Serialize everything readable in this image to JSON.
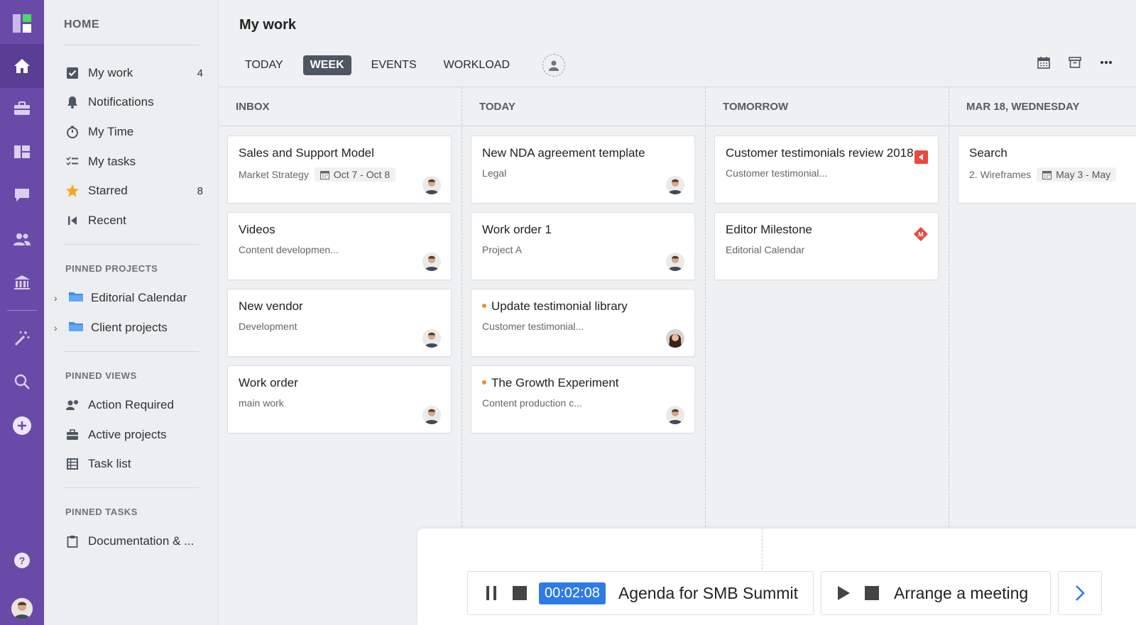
{
  "colors": {
    "rail": "#6a4aa8",
    "accent": "#2f7be5",
    "star": "#f5a623",
    "red_flag": "#e84a3c",
    "dot_orange": "#f28a33"
  },
  "rail": {
    "icons": [
      "logo-icon",
      "home-icon",
      "briefcase-icon",
      "dashboard-icon",
      "chat-icon",
      "users-icon",
      "bank-icon",
      "magic-wand-icon",
      "search-icon",
      "plus-icon",
      "help-icon"
    ]
  },
  "sidebar": {
    "home_label": "HOME",
    "items": [
      {
        "label": "My work",
        "count": "4",
        "icon": "checkbox-icon"
      },
      {
        "label": "Notifications",
        "count": "",
        "icon": "bell-icon"
      },
      {
        "label": "My Time",
        "count": "",
        "icon": "stopwatch-icon"
      },
      {
        "label": "My tasks",
        "count": "",
        "icon": "task-list-icon"
      },
      {
        "label": "Starred",
        "count": "8",
        "icon": "star-icon"
      },
      {
        "label": "Recent",
        "count": "",
        "icon": "recent-icon"
      }
    ],
    "pinned_projects_label": "PINNED PROJECTS",
    "pinned_projects": [
      "Editorial Calendar",
      "Client projects"
    ],
    "pinned_views_label": "PINNED VIEWS",
    "pinned_views": [
      {
        "label": "Action Required",
        "icon": "user-alert-icon"
      },
      {
        "label": "Active projects",
        "icon": "briefcase-icon"
      },
      {
        "label": "Task list",
        "icon": "table-icon"
      }
    ],
    "pinned_tasks_label": "PINNED TASKS",
    "pinned_tasks": [
      {
        "label": "Documentation & ...",
        "icon": "clipboard-icon"
      }
    ]
  },
  "header": {
    "title": "My work",
    "tabs": [
      "TODAY",
      "WEEK",
      "EVENTS",
      "WORKLOAD"
    ],
    "active_tab": "WEEK"
  },
  "columns": [
    {
      "title": "INBOX",
      "cards": [
        {
          "title": "Sales and Support Model",
          "sub": "Market Strategy",
          "date": "Oct 7 - Oct 8",
          "dot": false,
          "avatar": "man"
        },
        {
          "title": "Videos",
          "sub": "Content developmen...",
          "date": "",
          "dot": false,
          "avatar": "man"
        },
        {
          "title": "New vendor",
          "sub": "Development",
          "date": "",
          "dot": false,
          "avatar": "man"
        },
        {
          "title": "Work order",
          "sub": "main work",
          "date": "",
          "dot": false,
          "avatar": "man"
        }
      ]
    },
    {
      "title": "TODAY",
      "cards": [
        {
          "title": "New NDA agreement template",
          "sub": "Legal",
          "date": "",
          "dot": false,
          "avatar": "man"
        },
        {
          "title": "Work order 1",
          "sub": "Project A",
          "date": "",
          "dot": false,
          "avatar": "man"
        },
        {
          "title": "Update testimonial library",
          "sub": "Customer testimonial...",
          "date": "",
          "dot": true,
          "avatar": "woman"
        },
        {
          "title": "The Growth Experiment",
          "sub": "Content production c...",
          "date": "",
          "dot": true,
          "avatar": "man"
        }
      ]
    },
    {
      "title": "TOMORROW",
      "cards": [
        {
          "title": "Customer testimonials review 2018",
          "sub": "Customer testimonial...",
          "date": "",
          "dot": false,
          "avatar": "",
          "flag": "red-flag-icon"
        },
        {
          "title": "Editor Milestone",
          "sub": "Editorial Calendar",
          "date": "",
          "dot": false,
          "avatar": "",
          "flag": "milestone-icon"
        }
      ]
    },
    {
      "title": "MAR 18, WEDNESDAY",
      "cards": [
        {
          "title": "Search",
          "sub": "2. Wireframes",
          "date": "May 3 - May",
          "dot": false,
          "avatar": ""
        }
      ]
    }
  ],
  "timers": [
    {
      "time": "00:02:08",
      "name": "Agenda for SMB Summit",
      "running": true
    },
    {
      "time": "",
      "name": "Arrange a meeting",
      "running": false
    }
  ]
}
